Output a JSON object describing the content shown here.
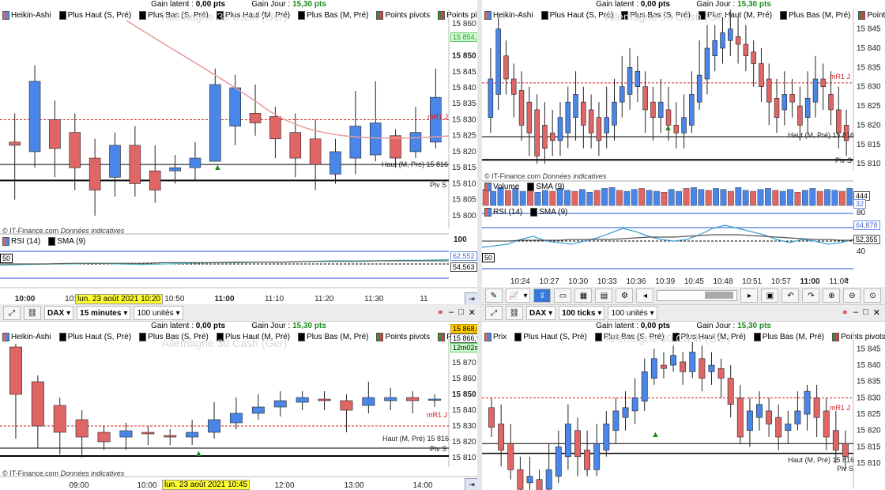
{
  "common": {
    "gain_latent_label": "Gain latent :",
    "gain_latent_value": "0,00 pts",
    "gain_jour_label": "Gain Jour :",
    "gain_jour_value": "15,30 pts",
    "copyright": "© IT-Finance.com",
    "indicative": "Données indicatives",
    "watermark": "Allemagne 30 Cash (Ger)",
    "mr1_label": "mR1 J",
    "piv_label": "Piv S",
    "haut_label_top_left": "Haut (M, Pré) 15 816",
    "haut_label": "Haut (M, Pré) 15 816"
  },
  "legend": {
    "heikin": "Heikin-Ashi",
    "plus_haut_s": "Plus Haut (S, Pré)",
    "plus_bas_s": "Plus Bas (S, Pré)",
    "plus_haut_m": "Plus Haut (M, Pré)",
    "plus_bas_m": "Plus Bas (M, Pré)",
    "points_pivots": "Points pivots",
    "points_pivots_m": "Points pivots (M",
    "prix": "Prix"
  },
  "panes": {
    "top_left": {
      "y_ticks": [
        "15 860",
        "15 850",
        "15 845",
        "15 840",
        "15 835",
        "15 830",
        "15 825",
        "15 820",
        "15 815",
        "15 810",
        "15 805",
        "15 800"
      ],
      "price_tag": "15 854,2",
      "rsi_label": "RSI (14)",
      "sma_label": "SMA (9)",
      "rsi_level": "50",
      "rsi_ticks": [
        "100"
      ],
      "rsi_value_tag": "62,552",
      "rsi_value_tag2": "54,563",
      "x_ticks": [
        "10:00",
        "10:30",
        "10:40",
        "10:50",
        "11:00",
        "11:10",
        "11:20",
        "11:30",
        "11"
      ],
      "date_tag": "lun. 23 août 2021 10:20"
    },
    "top_right": {
      "y_ticks": [
        "15 845",
        "15 840",
        "15 835",
        "15 830",
        "15 825",
        "15 820",
        "15 815",
        "15 810"
      ],
      "volume_label": "Volume",
      "sma_label": "SMA (9)",
      "vol_tag1": "444",
      "vol_tag2": "32",
      "vol_tick": "80",
      "rsi_label": "RSI (14)",
      "rsi_level": "50",
      "rsi_tag1": "64,878",
      "rsi_tag2": "52,355",
      "rsi_tick": "40",
      "x_ticks": [
        "10:24",
        "10:27",
        "10:30",
        "10:33",
        "10:36",
        "10:39",
        "10:45",
        "10:48",
        "10:51",
        "10:57",
        "11:00",
        "11:04"
      ]
    },
    "toolbar_mid": {
      "indicateurs": "Indicateurs"
    },
    "bottom_left": {
      "instrument": "DAX",
      "timeframe": "15 minutes",
      "units": "100 unités",
      "y_ticks": [
        "15 880",
        "15 870",
        "15 860",
        "15 850",
        "15 840",
        "15 830",
        "15 820",
        "15 810"
      ],
      "price_tag": "15 868,6",
      "price_tag2": "15 866,9",
      "countdown": "12m02s",
      "x_ticks": [
        "09:00",
        "10:00",
        "12:00",
        "13:00",
        "14:00"
      ],
      "date_tag": "lun. 23 août 2021 10:45"
    },
    "bottom_right": {
      "instrument": "DAX",
      "timeframe": "100 ticks",
      "units": "100 unités",
      "y_ticks": [
        "15 845",
        "15 840",
        "15 835",
        "15 830",
        "15 825",
        "15 820",
        "15 815",
        "15 810"
      ]
    }
  },
  "colors": {
    "bull": "#4a86e8",
    "bear": "#e06666",
    "mr1": "#d02020",
    "green": "#1a8a1a",
    "price_tag_bg": "#ccffcc"
  },
  "series": {
    "tl_candles": [
      [
        15823,
        15822,
        15832,
        15805
      ],
      [
        15820,
        15842,
        15847,
        15815
      ],
      [
        15830,
        15821,
        15836,
        15812
      ],
      [
        15826,
        15815,
        15832,
        15808
      ],
      [
        15818,
        15808,
        15824,
        15800
      ],
      [
        15812,
        15822,
        15826,
        15806
      ],
      [
        15822,
        15810,
        15828,
        15806
      ],
      [
        15814,
        15808,
        15822,
        15804
      ],
      [
        15814,
        15815,
        15819,
        15810
      ],
      [
        15815,
        15818,
        15823,
        15811
      ],
      [
        15817,
        15841,
        15846,
        15817
      ],
      [
        15828,
        15840,
        15844,
        15822
      ],
      [
        15832,
        15829,
        15841,
        15825
      ],
      [
        15831,
        15824,
        15834,
        15818
      ],
      [
        15826,
        15818,
        15832,
        15812
      ],
      [
        15824,
        15816,
        15830,
        15808
      ],
      [
        15813,
        15820,
        15824,
        15810
      ],
      [
        15818,
        15828,
        15839,
        15813
      ],
      [
        15819,
        15829,
        15842,
        15817
      ],
      [
        15825,
        15818,
        15827,
        15815
      ],
      [
        15820,
        15826,
        15834,
        15818
      ],
      [
        15823,
        15837,
        15846,
        15821
      ]
    ],
    "tr_candles": [
      [
        15822,
        15832,
        15840,
        15818
      ],
      [
        15828,
        15845,
        15848,
        15824
      ],
      [
        15838,
        15832,
        15842,
        15828
      ],
      [
        15832,
        15828,
        15836,
        15822
      ],
      [
        15829,
        15820,
        15834,
        15816
      ],
      [
        15826,
        15818,
        15830,
        15812
      ],
      [
        15824,
        15812,
        15828,
        15810
      ],
      [
        15820,
        15814,
        15826,
        15810
      ],
      [
        15818,
        15816,
        15824,
        15812
      ],
      [
        15816,
        15822,
        15826,
        15812
      ],
      [
        15818,
        15826,
        15830,
        15814
      ],
      [
        15822,
        15828,
        15834,
        15816
      ],
      [
        15826,
        15820,
        15830,
        15814
      ],
      [
        15824,
        15818,
        15828,
        15814
      ],
      [
        15822,
        15816,
        15826,
        15812
      ],
      [
        15818,
        15822,
        15830,
        15814
      ],
      [
        15820,
        15826,
        15832,
        15816
      ],
      [
        15826,
        15830,
        15838,
        15822
      ],
      [
        15828,
        15835,
        15840,
        15824
      ],
      [
        15830,
        15834,
        15838,
        15826
      ],
      [
        15830,
        15824,
        15834,
        15818
      ],
      [
        15826,
        15822,
        15830,
        15816
      ],
      [
        15822,
        15826,
        15832,
        15818
      ],
      [
        15824,
        15820,
        15830,
        15816
      ],
      [
        15820,
        15818,
        15826,
        15814
      ],
      [
        15818,
        15822,
        15828,
        15814
      ],
      [
        15820,
        15828,
        15834,
        15818
      ],
      [
        15826,
        15833,
        15842,
        15824
      ],
      [
        15832,
        15840,
        15846,
        15828
      ],
      [
        15838,
        15842,
        15846,
        15834
      ],
      [
        15840,
        15844,
        15848,
        15836
      ],
      [
        15842,
        15845,
        15850,
        15838
      ],
      [
        15843,
        15841,
        15848,
        15836
      ],
      [
        15841,
        15838,
        15846,
        15834
      ],
      [
        15839,
        15836,
        15842,
        15830
      ],
      [
        15836,
        15830,
        15840,
        15826
      ],
      [
        15832,
        15826,
        15836,
        15820
      ],
      [
        15827,
        15822,
        15832,
        15818
      ],
      [
        15824,
        15828,
        15834,
        15820
      ],
      [
        15828,
        15826,
        15832,
        15822
      ],
      [
        15825,
        15820,
        15830,
        15816
      ],
      [
        15822,
        15827,
        15834,
        15818
      ],
      [
        15826,
        15832,
        15838,
        15822
      ],
      [
        15832,
        15830,
        15836,
        15824
      ],
      [
        15828,
        15824,
        15834,
        15820
      ],
      [
        15824,
        15818,
        15830,
        15814
      ],
      [
        15820,
        15816,
        15824,
        15812
      ]
    ],
    "bl_candles": [
      [
        15880,
        15850,
        15882,
        15822
      ],
      [
        15858,
        15830,
        15862,
        15816
      ],
      [
        15843,
        15826,
        15848,
        15812
      ],
      [
        15834,
        15823,
        15840,
        15810
      ],
      [
        15826,
        15820,
        15830,
        15815
      ],
      [
        15823,
        15827,
        15832,
        15815
      ],
      [
        15826,
        15825,
        15830,
        15818
      ],
      [
        15824,
        15823,
        15828,
        15818
      ],
      [
        15823,
        15826,
        15834,
        15818
      ],
      [
        15826,
        15834,
        15845,
        15822
      ],
      [
        15832,
        15838,
        15848,
        15828
      ],
      [
        15838,
        15842,
        15850,
        15834
      ],
      [
        15842,
        15846,
        15852,
        15836
      ],
      [
        15845,
        15848,
        15852,
        15840
      ],
      [
        15847,
        15846,
        15852,
        15840
      ],
      [
        15846,
        15840,
        15850,
        15826
      ],
      [
        15843,
        15848,
        15858,
        15838
      ],
      [
        15846,
        15848,
        15854,
        15840
      ],
      [
        15848,
        15846,
        15852,
        15838
      ],
      [
        15847,
        15847,
        15850,
        15842
      ]
    ],
    "br_candles": [
      [
        15827,
        15821,
        15830,
        15818
      ],
      [
        15822,
        15814,
        15828,
        15809
      ],
      [
        15816,
        15808,
        15822,
        15805
      ],
      [
        15808,
        15802,
        15812,
        15798
      ],
      [
        15804,
        15806,
        15812,
        15800
      ],
      [
        15805,
        15800,
        15808,
        15795
      ],
      [
        15802,
        15808,
        15816,
        15798
      ],
      [
        15806,
        15815,
        15820,
        15804
      ],
      [
        15812,
        15822,
        15828,
        15808
      ],
      [
        15820,
        15812,
        15824,
        15806
      ],
      [
        15814,
        15808,
        15820,
        15806
      ],
      [
        15808,
        15816,
        15822,
        15806
      ],
      [
        15814,
        15822,
        15826,
        15812
      ],
      [
        15820,
        15826,
        15830,
        15816
      ],
      [
        15824,
        15827,
        15832,
        15820
      ],
      [
        15826,
        15830,
        15836,
        15822
      ],
      [
        15829,
        15838,
        15842,
        15826
      ],
      [
        15836,
        15842,
        15845,
        15834
      ],
      [
        15840,
        15839,
        15844,
        15836
      ],
      [
        15840,
        15843,
        15846,
        15838
      ],
      [
        15841,
        15838,
        15844,
        15834
      ],
      [
        15838,
        15844,
        15847,
        15836
      ],
      [
        15842,
        15836,
        15846,
        15832
      ],
      [
        15838,
        15840,
        15844,
        15834
      ],
      [
        15839,
        15836,
        15842,
        15830
      ],
      [
        15836,
        15828,
        15840,
        15824
      ],
      [
        15830,
        15818,
        15834,
        15816
      ],
      [
        15820,
        15826,
        15830,
        15815
      ],
      [
        15824,
        15828,
        15832,
        15820
      ],
      [
        15826,
        15822,
        15830,
        15818
      ],
      [
        15824,
        15818,
        15828,
        15814
      ],
      [
        15820,
        15822,
        15826,
        15816
      ],
      [
        15822,
        15826,
        15832,
        15820
      ],
      [
        15825,
        15832,
        15834,
        15820
      ],
      [
        15830,
        15824,
        15834,
        15818
      ],
      [
        15826,
        15818,
        15830,
        15814
      ],
      [
        15820,
        15814,
        15826,
        15810
      ],
      [
        15816,
        15812,
        15820,
        15808
      ]
    ],
    "tr_volume": [
      34,
      30,
      38,
      32,
      36,
      30,
      34,
      28,
      32,
      30,
      36,
      32,
      30,
      34,
      28,
      32,
      36,
      38,
      32,
      30,
      34,
      36,
      32,
      30,
      28,
      34,
      30,
      36,
      38,
      34,
      32,
      36,
      34,
      30,
      38,
      32,
      30,
      34,
      36,
      32,
      30,
      34,
      28,
      32,
      36,
      30,
      34,
      32,
      30,
      36
    ],
    "tl_rsi": [
      48,
      49,
      50,
      50,
      51,
      50,
      49,
      50,
      51,
      52,
      52,
      53,
      53,
      54,
      55,
      55,
      55,
      56,
      56,
      57
    ],
    "tl_sma": [
      50,
      50,
      50,
      51,
      51,
      51,
      51,
      52,
      52,
      52,
      53,
      53,
      53,
      54,
      54,
      54,
      55,
      55,
      55,
      55
    ],
    "tr_rsi": [
      42,
      44,
      46,
      52,
      56,
      50,
      48,
      46,
      50,
      54,
      60,
      66,
      62,
      56,
      52,
      50,
      52,
      58,
      66,
      70,
      66,
      62,
      58,
      52,
      48,
      52,
      50,
      46,
      48,
      52
    ],
    "tr_sma": [
      50,
      50,
      50,
      51,
      51,
      51,
      51,
      52,
      52,
      52,
      52,
      53,
      54,
      55,
      55,
      55,
      56,
      57,
      58,
      58,
      58,
      57,
      56,
      55,
      54,
      53,
      52,
      52,
      51,
      51
    ]
  }
}
